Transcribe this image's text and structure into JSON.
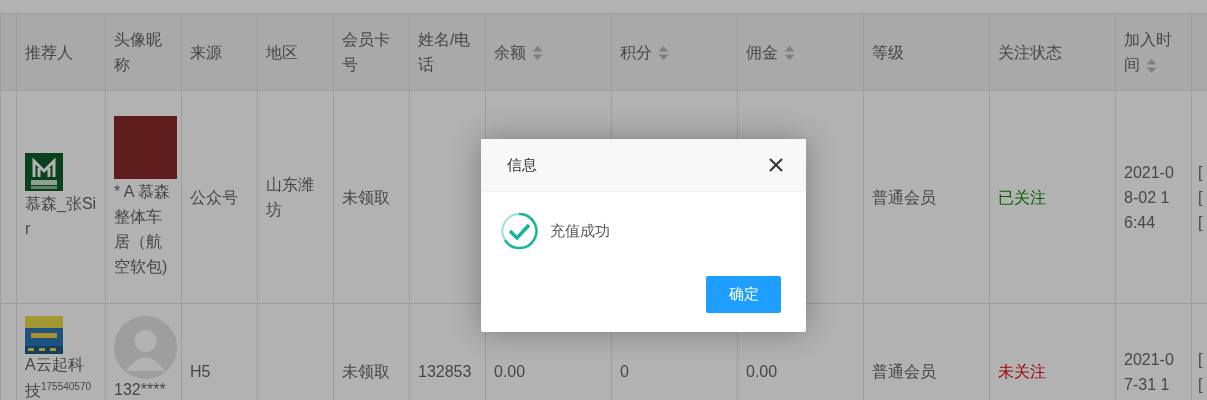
{
  "table": {
    "columns": [
      {
        "label": "推荐人",
        "sortable": false
      },
      {
        "label": "头像昵称",
        "sortable": false
      },
      {
        "label": "来源",
        "sortable": false
      },
      {
        "label": "地区",
        "sortable": false
      },
      {
        "label": "会员卡号",
        "sortable": false
      },
      {
        "label": "姓名/电话",
        "sortable": false
      },
      {
        "label": "余额",
        "sortable": true
      },
      {
        "label": "积分",
        "sortable": true
      },
      {
        "label": "佣金",
        "sortable": true
      },
      {
        "label": "等级",
        "sortable": false
      },
      {
        "label": "关注状态",
        "sortable": false
      },
      {
        "label": "加入时间",
        "sortable": true
      }
    ],
    "rows": [
      {
        "referrer": {
          "kind": "logo-letter",
          "name": "慕森_张Sir"
        },
        "nickname": {
          "kind": "photo",
          "text": "* A 慕森整体车居（航空软包)"
        },
        "source": "公众号",
        "region": "山东潍坊",
        "card": "未领取",
        "level": "普通会员",
        "follow": {
          "text": "已关注",
          "followed": true
        },
        "joined": "2021-08-02 16:44",
        "ops": [
          "[",
          "[",
          "["
        ]
      },
      {
        "referrer": {
          "kind": "logo-banner",
          "name": "A云起科技$^{175540570}$"
        },
        "nickname": {
          "kind": "default",
          "text": "132****"
        },
        "source": "H5",
        "card": "未领取",
        "name_phone": "132853",
        "balance": "0.00",
        "points": "0",
        "commission": "0.00",
        "level": "普通会员",
        "follow": {
          "text": "未关注",
          "followed": false
        },
        "joined": "2021-07-31 1",
        "ops": [
          "[",
          "["
        ]
      }
    ]
  },
  "dialog": {
    "title": "信息",
    "message": "充值成功",
    "confirm": "确定"
  }
}
